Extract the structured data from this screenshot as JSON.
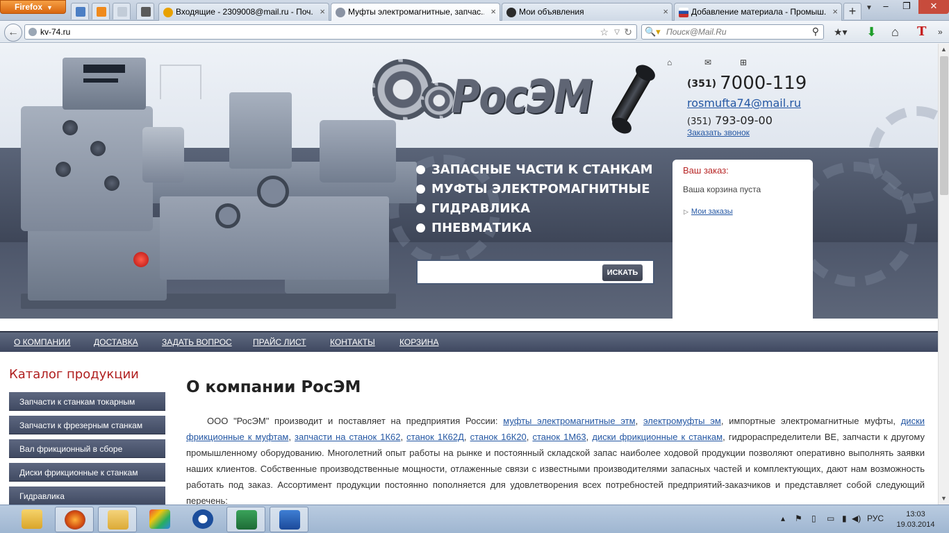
{
  "browser": {
    "menu_button": "Firefox",
    "tabs": [
      {
        "label": "Входящие - 2309008@mail.ru - Поч...",
        "active": false,
        "favicon_color": "#e8a100"
      },
      {
        "label": "Муфты электромагнитные, запчас...",
        "active": true,
        "favicon_color": "#8a93a3"
      },
      {
        "label": "Мои объявления",
        "active": false,
        "favicon_color": "#2b2b2b"
      },
      {
        "label": "Добавление материала - Промыш...",
        "active": false,
        "favicon_color": "#c9302c"
      }
    ],
    "new_tab": "+",
    "url": "kv-74.ru",
    "search_placeholder": "Поиск@Mail.Ru"
  },
  "header": {
    "logo_text": "РосЭМ",
    "phone_main_code": "(351)",
    "phone_main_number": "7000-119",
    "email": "rosmufta74@mail.ru",
    "phone_second_code": "(351)",
    "phone_second_number": "793-09-00",
    "callback_link": "Заказать звонок",
    "top_icons": [
      "home-icon",
      "mail-icon",
      "sitemap-icon"
    ],
    "menu": [
      "ЗАПАСНЫЕ ЧАСТИ К СТАНКАМ",
      "МУФТЫ ЭЛЕКТРОМАГНИТНЫЕ",
      "ГИДРАВЛИКА",
      "ПНЕВМАТИКА"
    ],
    "search_button": "ИСКАТЬ",
    "search_value": ""
  },
  "cart": {
    "title": "Ваш заказ:",
    "empty_text": "Ваша корзина пуста",
    "orders_link": "Мои заказы"
  },
  "nav": [
    "О КОМПАНИИ",
    "ДОСТАВКА",
    "ЗАДАТЬ ВОПРОС",
    "ПРАЙС ЛИСТ",
    "КОНТАКТЫ",
    "КОРЗИНА"
  ],
  "catalog": {
    "title": "Каталог продукции",
    "items": [
      "Запчасти к станкам токарным",
      "Запчасти к фрезерным станкам",
      "Вал фрикционный в сборе",
      "Диски фрикционные к станкам",
      "Гидравлика"
    ]
  },
  "content": {
    "title": "О компании РосЭМ",
    "p_intro": "ООО \"РосЭМ\" производит и поставляет на предприятия России: ",
    "link1": "муфты электромагнитные этм",
    "sep1": ", ",
    "link2": "электромуфты эм",
    "mid1": ", импортные электромагнитные муфты, ",
    "link3": "диски фрикционные к муфтам",
    "sep2": ", ",
    "link4": "запчасти на станок 1К62",
    "sep3": ", ",
    "link5": "станок 1К62Д",
    "sep4": ", ",
    "link6": "станок 16К20",
    "sep5": ", ",
    "link7": "станок 1М63",
    "sep6": ", ",
    "link8": "диски фрикционные к станкам",
    "p_rest": ", гидрораспределители ВЕ, запчасти к другому промышленному оборудованию. Многолетний опыт работы на рынке и постоянный складской запас наиболее ходовой продукции позволяют оперативно выполнять заявки наших клиентов. Собственные производственные мощности, отлаженные связи с известными производителями запасных частей и комплектующих, дают нам возможность работать под заказ. Ассортимент продукции постоянно пополняется для удовлетворения всех потребностей предприятий-заказчиков и представляет собой следующий перечень:"
  },
  "taskbar": {
    "apps": [
      "explorer-icon",
      "firefox-icon",
      "outlook-icon",
      "paint-icon",
      "nero-icon",
      "excel-icon",
      "word-icon"
    ],
    "language": "РУС",
    "time": "13:03",
    "date": "19.03.2014"
  }
}
